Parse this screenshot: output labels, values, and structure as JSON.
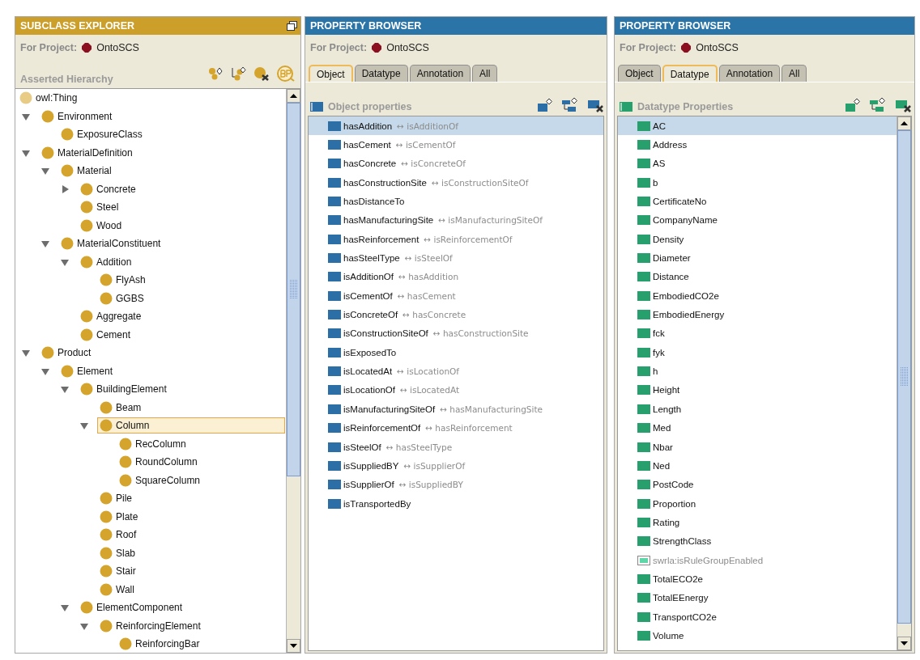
{
  "subclass_explorer": {
    "title": "SUBCLASS EXPLORER",
    "project_label": "For Project:",
    "project_name": "OntoSCS",
    "hierarchy_label": "Asserted Hierarchy",
    "root": {
      "label": "owl:Thing",
      "selected": false
    },
    "tree": [
      {
        "label": "Environment",
        "expanded": true,
        "selected": false,
        "children": [
          {
            "label": "ExposureClass",
            "selected": false
          }
        ]
      },
      {
        "label": "MaterialDefinition",
        "expanded": true,
        "selected": false,
        "children": [
          {
            "label": "Material",
            "expanded": true,
            "selected": false,
            "children": [
              {
                "label": "Concrete",
                "expanded": false,
                "selected": false
              },
              {
                "label": "Steel",
                "selected": false
              },
              {
                "label": "Wood",
                "selected": false
              }
            ]
          },
          {
            "label": "MaterialConstituent",
            "expanded": true,
            "selected": false,
            "children": [
              {
                "label": "Addition",
                "expanded": true,
                "selected": false,
                "children": [
                  {
                    "label": "FlyAsh",
                    "selected": false
                  },
                  {
                    "label": "GGBS",
                    "selected": false
                  }
                ]
              },
              {
                "label": "Aggregate",
                "selected": false
              },
              {
                "label": "Cement",
                "selected": false
              }
            ]
          }
        ]
      },
      {
        "label": "Product",
        "expanded": true,
        "selected": false,
        "children": [
          {
            "label": "Element",
            "expanded": true,
            "selected": false,
            "children": [
              {
                "label": "BuildingElement",
                "expanded": true,
                "selected": false,
                "children": [
                  {
                    "label": "Beam",
                    "selected": false
                  },
                  {
                    "label": "Column",
                    "expanded": true,
                    "selected": true,
                    "children": [
                      {
                        "label": "RecColumn",
                        "selected": false
                      },
                      {
                        "label": "RoundColumn",
                        "selected": false
                      },
                      {
                        "label": "SquareColumn",
                        "selected": false
                      }
                    ]
                  },
                  {
                    "label": "Pile",
                    "selected": false
                  },
                  {
                    "label": "Plate",
                    "selected": false
                  },
                  {
                    "label": "Roof",
                    "selected": false
                  },
                  {
                    "label": "Slab",
                    "selected": false
                  },
                  {
                    "label": "Stair",
                    "selected": false
                  },
                  {
                    "label": "Wall",
                    "selected": false
                  }
                ]
              },
              {
                "label": "ElementComponent",
                "expanded": true,
                "selected": false,
                "children": [
                  {
                    "label": "ReinforcingElement",
                    "expanded": true,
                    "selected": false,
                    "children": [
                      {
                        "label": "ReinforcingBar",
                        "selected": false
                      }
                    ]
                  }
                ]
              }
            ]
          }
        ]
      }
    ]
  },
  "property_browsers": [
    {
      "kind": "object",
      "title": "PROPERTY BROWSER",
      "project_label": "For Project:",
      "project_name": "OntoSCS",
      "tabs": [
        {
          "label": "Object",
          "selected": true
        },
        {
          "label": "Datatype",
          "selected": false
        },
        {
          "label": "Annotation",
          "selected": false
        },
        {
          "label": "All",
          "selected": false
        }
      ],
      "list_label": "Object properties",
      "scrollbar": false,
      "items": [
        {
          "name": "hasAddition",
          "inverse": "↔ isAdditionOf",
          "selected": true
        },
        {
          "name": "hasCement",
          "inverse": "↔ isCementOf",
          "selected": false
        },
        {
          "name": "hasConcrete",
          "inverse": "↔ isConcreteOf",
          "selected": false
        },
        {
          "name": "hasConstructionSite",
          "inverse": "↔ isConstructionSiteOf",
          "selected": false
        },
        {
          "name": "hasDistanceTo",
          "selected": false
        },
        {
          "name": "hasManufacturingSite",
          "inverse": "↔ isManufacturingSiteOf",
          "selected": false
        },
        {
          "name": "hasReinforcement",
          "inverse": "↔ isReinforcementOf",
          "selected": false
        },
        {
          "name": "hasSteelType",
          "inverse": "↔ isSteelOf",
          "selected": false
        },
        {
          "name": "isAdditionOf",
          "inverse": "↔ hasAddition",
          "selected": false
        },
        {
          "name": "isCementOf",
          "inverse": "↔ hasCement",
          "selected": false
        },
        {
          "name": "isConcreteOf",
          "inverse": "↔ hasConcrete",
          "selected": false
        },
        {
          "name": "isConstructionSiteOf",
          "inverse": "↔ hasConstructionSite",
          "selected": false
        },
        {
          "name": "isExposedTo",
          "selected": false
        },
        {
          "name": "isLocatedAt",
          "inverse": "↔ isLocationOf",
          "selected": false
        },
        {
          "name": "isLocationOf",
          "inverse": "↔ isLocatedAt",
          "selected": false
        },
        {
          "name": "isManufacturingSiteOf",
          "inverse": "↔ hasManufacturingSite",
          "selected": false
        },
        {
          "name": "isReinforcementOf",
          "inverse": "↔ hasReinforcement",
          "selected": false
        },
        {
          "name": "isSteelOf",
          "inverse": "↔ hasSteelType",
          "selected": false
        },
        {
          "name": "isSuppliedBY",
          "inverse": "↔ isSupplierOf",
          "selected": false
        },
        {
          "name": "isSupplierOf",
          "inverse": "↔ isSuppliedBY",
          "selected": false
        },
        {
          "name": "isTransportedBy",
          "selected": false
        }
      ]
    },
    {
      "kind": "datatype",
      "title": "PROPERTY BROWSER",
      "project_label": "For Project:",
      "project_name": "OntoSCS",
      "tabs": [
        {
          "label": "Object",
          "selected": false
        },
        {
          "label": "Datatype",
          "selected": true
        },
        {
          "label": "Annotation",
          "selected": false
        },
        {
          "label": "All",
          "selected": false
        }
      ],
      "list_label": "Datatype Properties",
      "scrollbar": true,
      "items": [
        {
          "name": "AC",
          "system": false,
          "selected": true
        },
        {
          "name": "Address",
          "system": false,
          "selected": false
        },
        {
          "name": "AS",
          "system": false,
          "selected": false
        },
        {
          "name": "b",
          "system": false,
          "selected": false
        },
        {
          "name": "CertificateNo",
          "system": false,
          "selected": false
        },
        {
          "name": "CompanyName",
          "system": false,
          "selected": false
        },
        {
          "name": "Density",
          "system": false,
          "selected": false
        },
        {
          "name": "Diameter",
          "system": false,
          "selected": false
        },
        {
          "name": "Distance",
          "system": false,
          "selected": false
        },
        {
          "name": "EmbodiedCO2e",
          "system": false,
          "selected": false
        },
        {
          "name": "EmbodiedEnergy",
          "system": false,
          "selected": false
        },
        {
          "name": "fck",
          "system": false,
          "selected": false
        },
        {
          "name": "fyk",
          "system": false,
          "selected": false
        },
        {
          "name": "h",
          "system": false,
          "selected": false
        },
        {
          "name": "Height",
          "system": false,
          "selected": false
        },
        {
          "name": "Length",
          "system": false,
          "selected": false
        },
        {
          "name": "Med",
          "system": false,
          "selected": false
        },
        {
          "name": "Nbar",
          "system": false,
          "selected": false
        },
        {
          "name": "Ned",
          "system": false,
          "selected": false
        },
        {
          "name": "PostCode",
          "system": false,
          "selected": false
        },
        {
          "name": "Proportion",
          "system": false,
          "selected": false
        },
        {
          "name": "Rating",
          "system": false,
          "selected": false
        },
        {
          "name": "StrengthClass",
          "system": false,
          "selected": false
        },
        {
          "name": "swrla:isRuleGroupEnabled",
          "system": true,
          "selected": false
        },
        {
          "name": "TotalECO2e",
          "system": false,
          "selected": false
        },
        {
          "name": "TotalEEnergy",
          "system": false,
          "selected": false
        },
        {
          "name": "TransportCO2e",
          "system": false,
          "selected": false
        },
        {
          "name": "Volume",
          "system": false,
          "selected": false
        }
      ]
    }
  ]
}
